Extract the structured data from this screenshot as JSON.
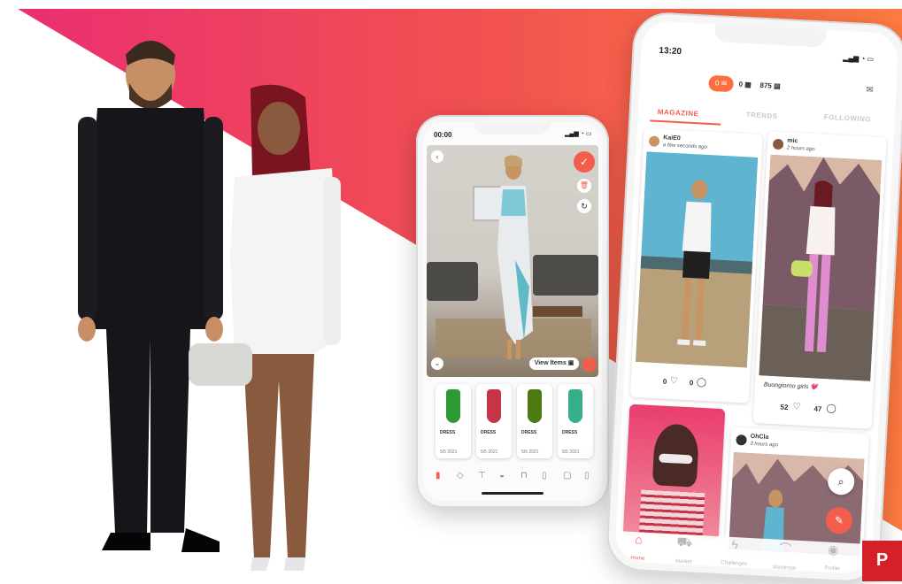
{
  "colors": {
    "accent": "#f05a4a",
    "pink": "#e9306e",
    "orange": "#ff7a45",
    "pinterest": "#d62027"
  },
  "left_phone": {
    "time": "00:00",
    "view_items_label": "View Items",
    "items": [
      {
        "category": "DRESS",
        "date": "5/5 2021",
        "color": "#2e9a36"
      },
      {
        "category": "DRESS",
        "date": "5/5 2021",
        "color": "#c63447"
      },
      {
        "category": "DRESS",
        "date": "5/5 2021",
        "color": "#4d7a14"
      },
      {
        "category": "DRESS",
        "date": "5/5 2021",
        "color": "#36b08a"
      }
    ]
  },
  "right_phone": {
    "time": "13:20",
    "counters": {
      "messages": "0",
      "gems": "0",
      "coins": "875"
    },
    "tabs": {
      "magazine": "MAGAZINE",
      "trends": "TRENDS",
      "following": "FOLLOWING"
    },
    "posts": [
      {
        "user": "KaiE0",
        "time": "a few seconds ago",
        "likes": "0",
        "comments": "0",
        "caption": ""
      },
      {
        "user": "mic",
        "time": "2 hours ago",
        "likes": "52",
        "comments": "47",
        "caption": "Buongiorno girls 💗"
      },
      {
        "user": "OhCla",
        "time": "3 hours ago"
      }
    ],
    "nav": {
      "home": "Home",
      "market": "Market",
      "challenges": "Challenges",
      "wardrobe": "Wardrobe",
      "profile": "Profile"
    }
  },
  "icons": {
    "pinterest": "P"
  }
}
